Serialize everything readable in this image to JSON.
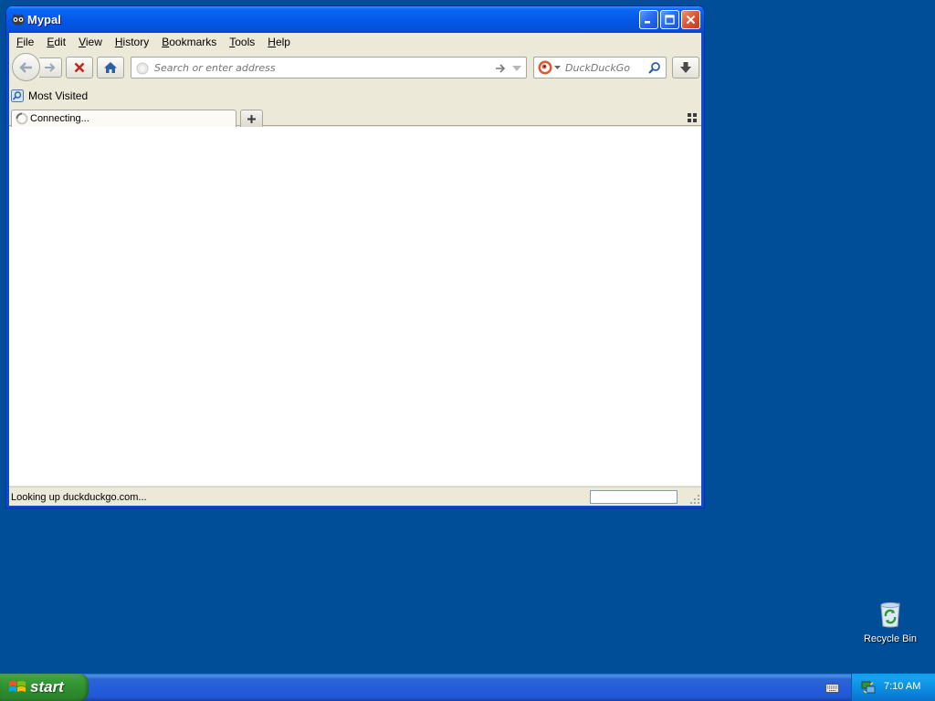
{
  "window": {
    "title": "Mypal",
    "menu": {
      "file": {
        "label": "File",
        "access": "F",
        "rest": "ile"
      },
      "edit": {
        "label": "Edit",
        "access": "E",
        "rest": "dit"
      },
      "view": {
        "label": "View",
        "access": "V",
        "rest": "iew"
      },
      "history": {
        "label": "History",
        "access": "H",
        "rest": "istory",
        "pre": ""
      },
      "bookmarks": {
        "label": "Bookmarks",
        "access": "B",
        "rest": "ookmarks"
      },
      "tools": {
        "label": "Tools",
        "access": "T",
        "rest": "ools"
      },
      "help": {
        "label": "Help",
        "access": "H",
        "rest": "elp"
      }
    },
    "navbar": {
      "url_value": "",
      "url_placeholder": "Search or enter address",
      "search_engine": "DuckDuckGo",
      "search_value": "",
      "search_placeholder": "DuckDuckGo"
    },
    "bookmarks": [
      {
        "label": "Most Visited",
        "icon": "most-visited-icon"
      }
    ],
    "tabs": [
      {
        "title": "Connecting...",
        "loading": true,
        "active": true
      }
    ],
    "status": {
      "text": "Looking up duckduckgo.com..."
    }
  },
  "desktop": {
    "icons": [
      {
        "label": "Recycle Bin",
        "icon": "recycle-bin-icon"
      }
    ]
  },
  "taskbar": {
    "start_label": "start",
    "clock": "7:10 AM"
  },
  "colors": {
    "desktop": "#004e98",
    "titlebar": "#0558e8",
    "chrome": "#ece9d8",
    "start_green": "#3c9f3c",
    "tray_blue": "#0b8ae0"
  }
}
